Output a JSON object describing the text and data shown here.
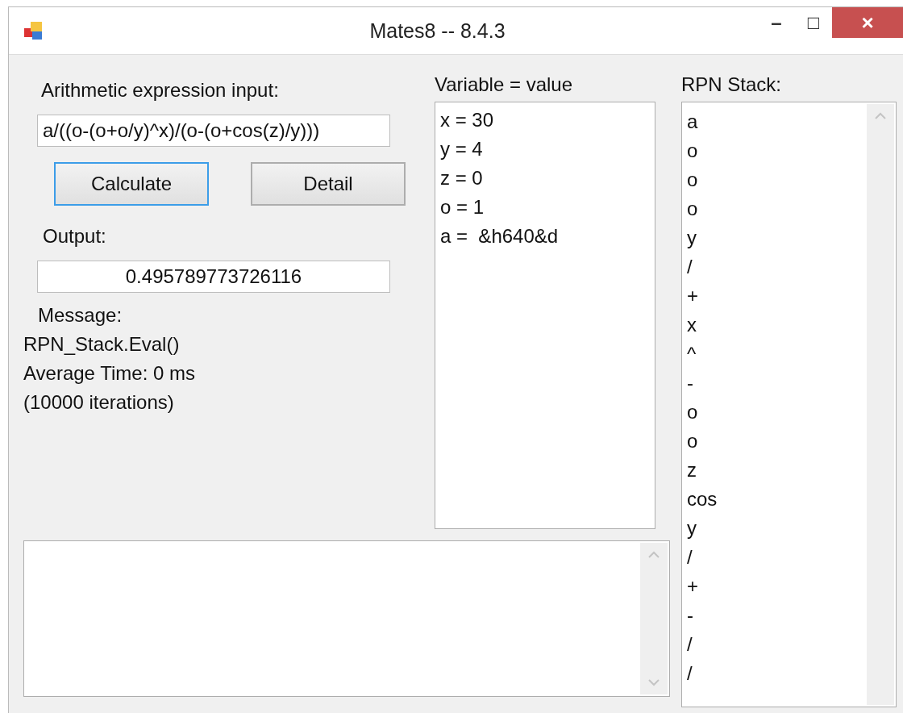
{
  "window": {
    "title": "Mates8 -- 8.4.3",
    "controls": [
      "–",
      "□",
      "×"
    ]
  },
  "expression": {
    "label": "Arithmetic expression input:",
    "value": "a/((o-(o+o/y)^x)/(o-(o+cos(z)/y)))"
  },
  "buttons": [
    {
      "label": "Calculate",
      "focused": true
    },
    {
      "label": "Detail",
      "focused": false
    }
  ],
  "output": {
    "label": "Output:",
    "value": "0.495789773726116"
  },
  "message": {
    "label": "Message:",
    "lines": [
      "RPN_Stack.Eval()",
      "Average Time: 0 ms",
      "(10000 iterations)"
    ]
  },
  "variables": {
    "label": "Variable = value",
    "lines": [
      "x = 30",
      "y = 4",
      "z = 0",
      "o = 1",
      "a =  &h640&d"
    ]
  },
  "rpn_stack": {
    "label": "RPN Stack:",
    "items": [
      "a",
      "o",
      "o",
      "o",
      "y",
      "/",
      "+",
      "x",
      "^",
      "-",
      "o",
      "o",
      "z",
      "cos",
      "y",
      "/",
      "+",
      "-",
      "/",
      "/"
    ]
  }
}
